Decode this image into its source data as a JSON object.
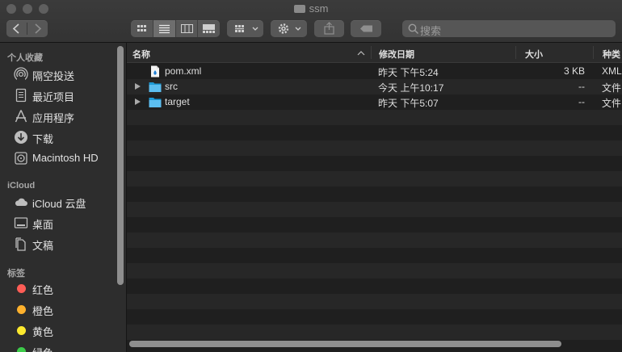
{
  "window": {
    "title": "ssm"
  },
  "toolbar": {
    "search_placeholder": "搜索",
    "buttons": [
      "back-icon",
      "forward-icon",
      "icon-view-icon",
      "list-view-icon",
      "column-view-icon",
      "gallery-view-icon",
      "group-icon",
      "action-gear-icon",
      "share-icon",
      "tag-icon"
    ]
  },
  "sidebar": {
    "favorites_header": "个人收藏",
    "favorites": [
      {
        "label": "隔空投送",
        "icon": "airdrop-icon"
      },
      {
        "label": "最近项目",
        "icon": "recents-icon"
      },
      {
        "label": "应用程序",
        "icon": "applications-icon"
      },
      {
        "label": "下载",
        "icon": "downloads-icon"
      },
      {
        "label": "Macintosh HD",
        "icon": "hard-drive-icon"
      }
    ],
    "icloud_header": "iCloud",
    "icloud": [
      {
        "label": "iCloud 云盘",
        "icon": "icloud-icon"
      },
      {
        "label": "桌面",
        "icon": "desktop-icon"
      },
      {
        "label": "文稿",
        "icon": "documents-icon"
      }
    ],
    "tags_header": "标签",
    "tags": [
      {
        "label": "红色",
        "color": "#fe5d56"
      },
      {
        "label": "橙色",
        "color": "#fdb12d"
      },
      {
        "label": "黄色",
        "color": "#fde92e"
      },
      {
        "label": "绿色",
        "color": "#3dcc4a"
      }
    ]
  },
  "list": {
    "columns": {
      "name": "名称",
      "modified": "修改日期",
      "size": "大小",
      "kind": "种类"
    },
    "rows": [
      {
        "name": "pom.xml",
        "modified": "昨天 下午5:24",
        "size": "3 KB",
        "kind": "XML",
        "type": "file"
      },
      {
        "name": "src",
        "modified": "今天 上午10:17",
        "size": "--",
        "kind": "文件",
        "type": "folder"
      },
      {
        "name": "target",
        "modified": "昨天 下午5:07",
        "size": "--",
        "kind": "文件",
        "type": "folder"
      }
    ]
  }
}
